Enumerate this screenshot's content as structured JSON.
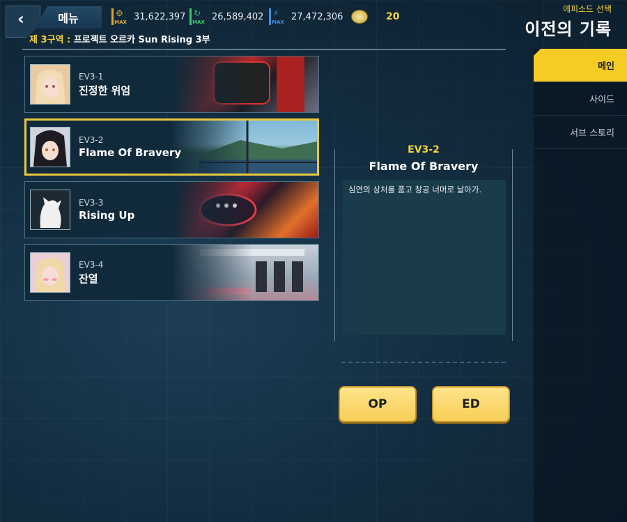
{
  "header": {
    "menu_label": "메뉴",
    "back_icon": "chevron-left-icon",
    "resources": [
      {
        "icon": "gear-max-icon",
        "color": "#e0a437",
        "symbol": "⚙",
        "max_label": "MAX",
        "value": "31,622,397"
      },
      {
        "icon": "refresh-max-icon",
        "color": "#3cc46a",
        "symbol": "↻",
        "max_label": "MAX",
        "value": "26,589,402"
      },
      {
        "icon": "lightning-max-icon",
        "color": "#3d8fe0",
        "symbol": "⚡",
        "max_label": "MAX",
        "value": "27,472,306"
      }
    ],
    "ticket": {
      "icon": "coin-icon",
      "value": "20"
    },
    "subtitle": "에피소드 선택",
    "title": "이전의 기록"
  },
  "region": {
    "prefix": "제 3구역 :",
    "name": "프로젝트 오르카 Sun Rising 3부"
  },
  "episodes": [
    {
      "code": "EV3-1",
      "name": "진정한 위엄",
      "portrait": "blonde-girl-portrait",
      "selected": false
    },
    {
      "code": "EV3-2",
      "name": "Flame Of Bravery",
      "portrait": "dark-hair-girl-portrait",
      "selected": true
    },
    {
      "code": "EV3-3",
      "name": "Rising Up",
      "portrait": "silhouette-portrait",
      "selected": false
    },
    {
      "code": "EV3-4",
      "name": "잔열",
      "portrait": "blonde-twin-girl-portrait",
      "selected": false
    }
  ],
  "detail": {
    "code": "EV3-2",
    "title": "Flame Of Bravery",
    "description": "심연의 상처를 품고 창공 너머로 날아가."
  },
  "buttons": {
    "op": "OP",
    "ed": "ED"
  },
  "tabs": [
    {
      "label": "메인",
      "active": true
    },
    {
      "label": "사이드",
      "active": false
    },
    {
      "label": "서브 스토리",
      "active": false
    }
  ],
  "colors": {
    "accent": "#f3d23c",
    "tab_active": "#f5cc24",
    "button": "#f7cf56"
  }
}
